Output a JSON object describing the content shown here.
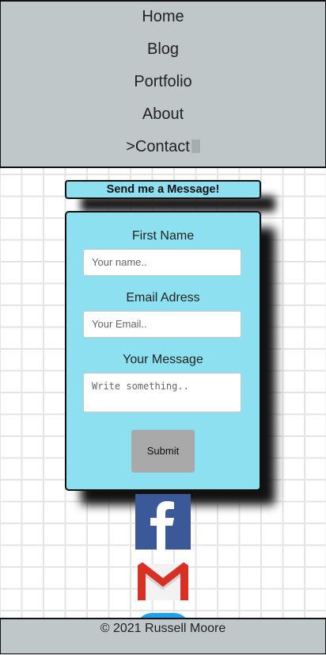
{
  "nav": {
    "items": [
      "Home",
      "Blog",
      "Portfolio",
      "About"
    ],
    "current_prefix": ">",
    "current": "Contact"
  },
  "form": {
    "title": "Send me a Message!",
    "name_label": "First Name",
    "name_placeholder": "Your name..",
    "email_label": "Email Adress",
    "email_placeholder": "Your Email..",
    "message_label": "Your Message",
    "message_placeholder": "Write something..",
    "submit_label": "Submit"
  },
  "social": {
    "facebook_icon": "facebook-icon",
    "gmail_icon": "gmail-icon",
    "twitter_icon": "twitter-icon",
    "colors": {
      "facebook": "#3b5998",
      "gmail_red": "#d93025",
      "twitter": "#1da1f2"
    }
  },
  "footer": {
    "text": "© 2021 Russell Moore"
  },
  "colors": {
    "nav_bg": "#bfc7c9",
    "card_bg": "#8de0ef",
    "submit_bg": "#a9a9a9"
  }
}
